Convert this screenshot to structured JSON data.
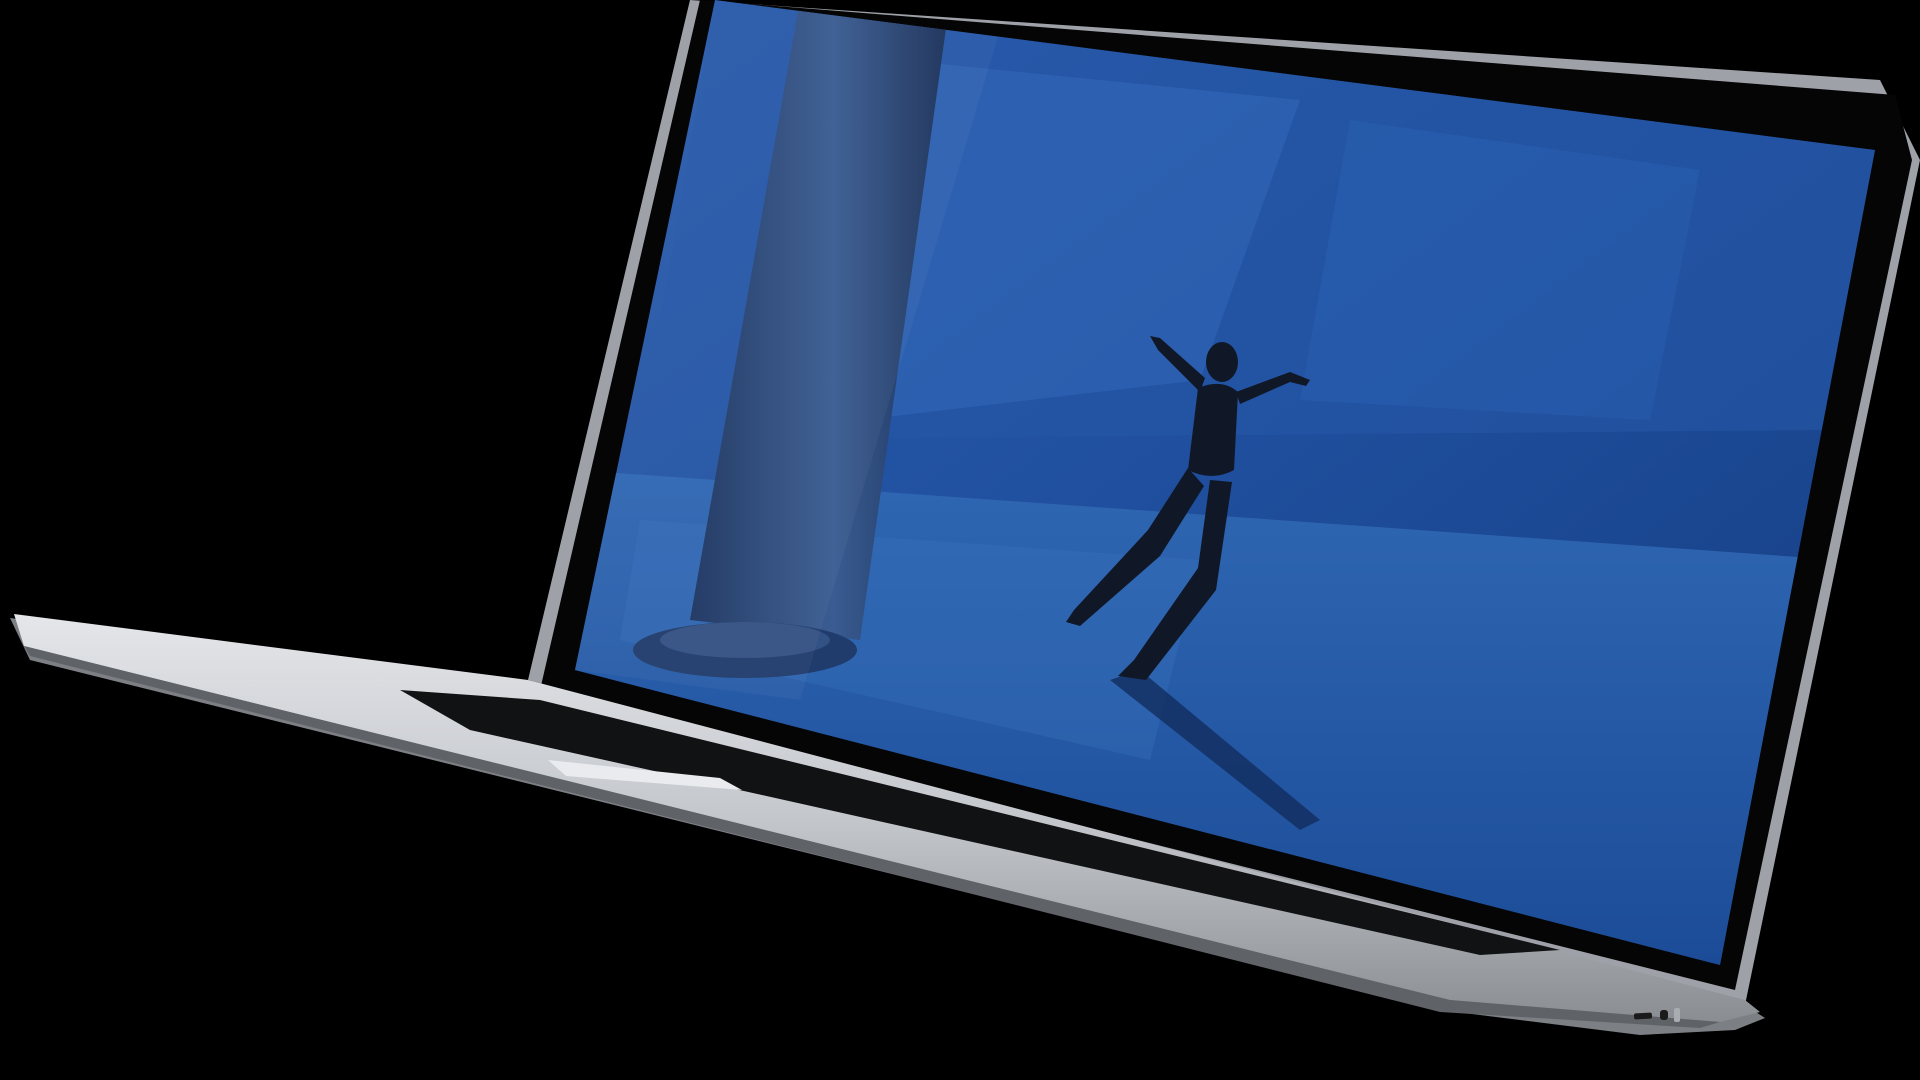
{
  "scene": {
    "subject": "laptop-mockup",
    "colors": {
      "page_background": "#000000",
      "laptop_body": "#c9ccd0",
      "laptop_body_shadow": "#8e9196",
      "bezel": "#050505",
      "keyboard": "#111214",
      "screen_water": "#1f4f9e",
      "screen_water_deep": "#143a7c",
      "screen_floor": "#2b62ad",
      "column": "#2c4a7a",
      "dancer": "#101828"
    },
    "icons": {
      "port_left": "usb-port-icon",
      "port_right": "headphone-port-icon"
    }
  }
}
